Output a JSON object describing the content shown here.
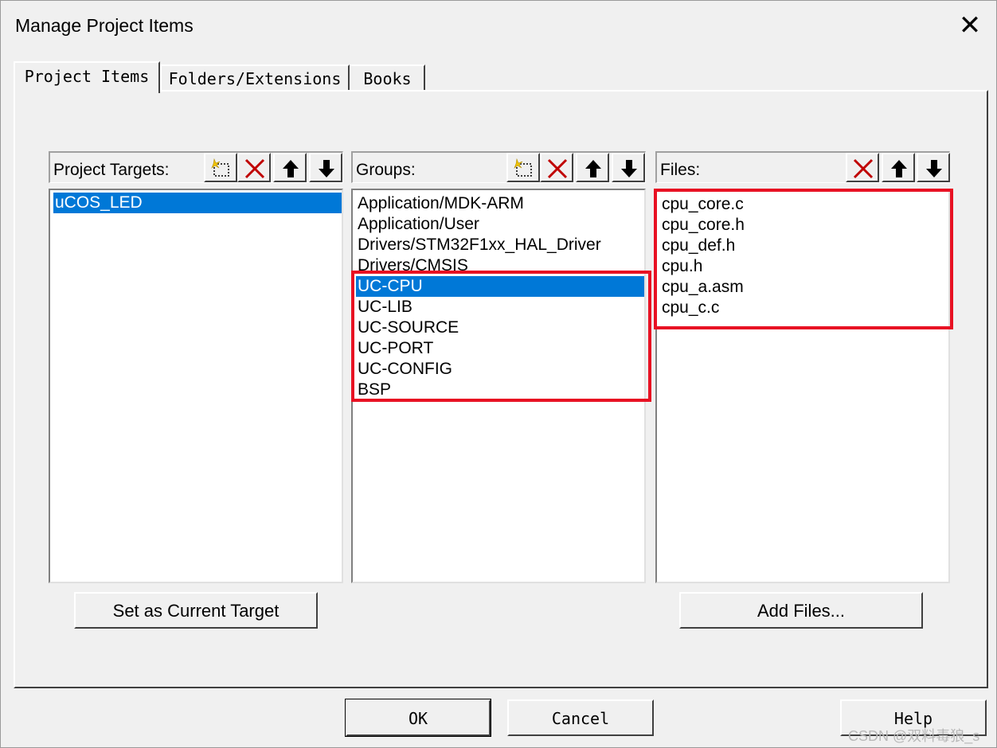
{
  "window": {
    "title": "Manage Project Items",
    "close_glyph": "✕"
  },
  "tabs": [
    {
      "label": "Project Items",
      "active": true
    },
    {
      "label": "Folders/Extensions",
      "active": false
    },
    {
      "label": "Books",
      "active": false
    }
  ],
  "targets": {
    "label": "Project Targets:",
    "items": [
      "uCOS_LED"
    ],
    "selected": "uCOS_LED",
    "toolbar": [
      "new-icon",
      "delete-icon",
      "move-up-icon",
      "move-down-icon"
    ]
  },
  "groups": {
    "label": "Groups:",
    "items": [
      "Application/MDK-ARM",
      "Application/User",
      "Drivers/STM32F1xx_HAL_Driver",
      "Drivers/CMSIS",
      "UC-CPU",
      "UC-LIB",
      "UC-SOURCE",
      "UC-PORT",
      "UC-CONFIG",
      "BSP"
    ],
    "selected": "UC-CPU",
    "toolbar": [
      "new-icon",
      "delete-icon",
      "move-up-icon",
      "move-down-icon"
    ]
  },
  "files": {
    "label": "Files:",
    "items": [
      "cpu_core.c",
      "cpu_core.h",
      "cpu_def.h",
      "cpu.h",
      "cpu_a.asm",
      "cpu_c.c"
    ],
    "toolbar": [
      "delete-icon",
      "move-up-icon",
      "move-down-icon"
    ]
  },
  "buttons": {
    "set_target": "Set as Current Target",
    "add_files": "Add Files...",
    "ok": "OK",
    "cancel": "Cancel",
    "help": "Help"
  },
  "watermark": "CSDN @双料毒狼_s",
  "colors": {
    "selection": "#0078d7",
    "highlight_box": "#e81123",
    "delete_icon": "#c00000"
  }
}
